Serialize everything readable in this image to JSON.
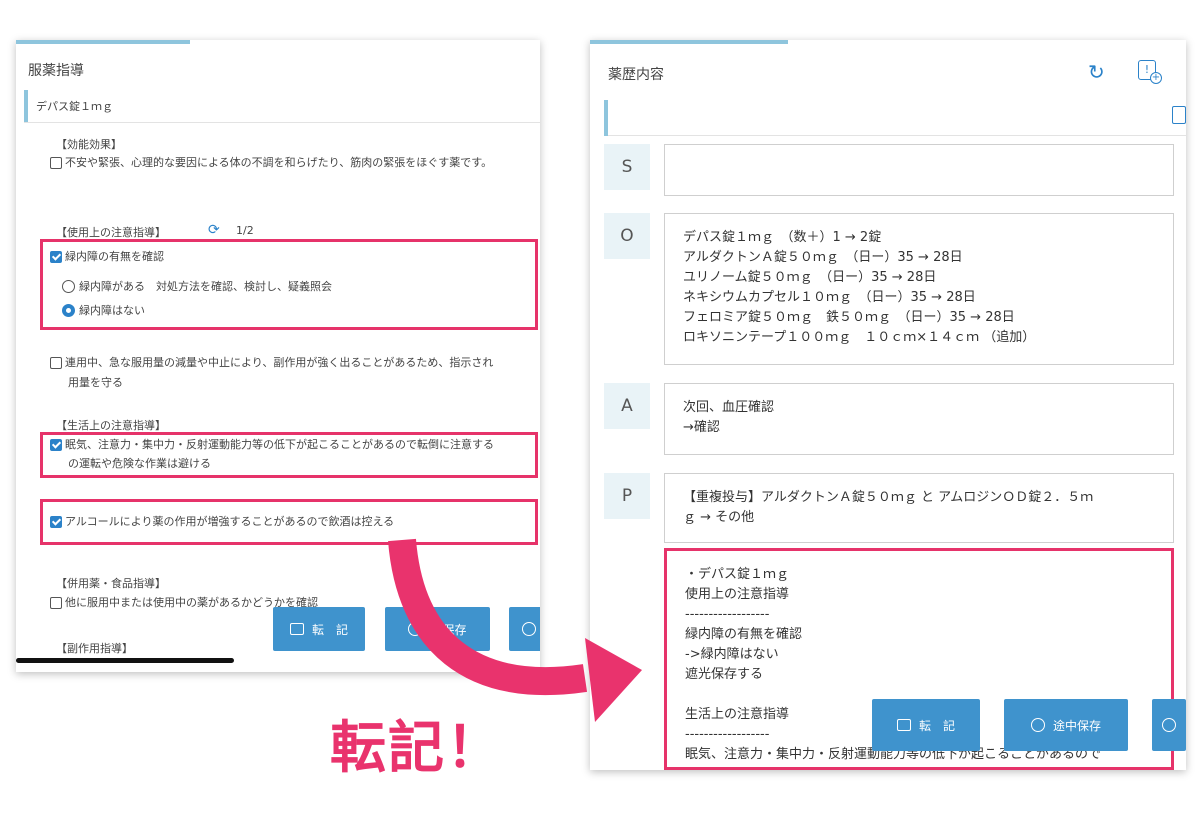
{
  "left_panel": {
    "title": "服薬指導",
    "drug": "デパス錠１ｍｇ",
    "effect_heading": "【効能効果】",
    "effect_text": "不安や緊張、心理的な要因による体の不調を和らげたり、筋肉の緊張をほぐす薬です。",
    "usage_heading": "【使用上の注意指導】",
    "usage_page": "1/2",
    "glaucoma_check": "緑内障の有無を確認",
    "radio_option_1": "緑内障がある　対処方法を確認、検討し、疑義照会",
    "radio_option_2": "緑内障はない",
    "dose_note_line1": "連用中、急な服用量の減量や中止により、副作用が強く出ることがあるため、指示され",
    "dose_note_line2": "用量を守る",
    "life_heading": "【生活上の注意指導】",
    "drowsy_line1": "眠気、注意力・集中力・反射運動能力等の低下が起こることがあるので転倒に注意する",
    "drowsy_line2": "の運転や危険な作業は避ける",
    "alcohol": "アルコールにより薬の作用が増強することがあるので飲酒は控える",
    "combo_heading": "【併用薬・食品指導】",
    "combo_check": "他に服用中または使用中の薬があるかどうかを確認",
    "side_heading": "【副作用指導】",
    "btn_transfer": "転　記",
    "btn_save": "中保存"
  },
  "right_panel": {
    "title": "薬歴内容",
    "s_label": "S",
    "s_text": "",
    "o_label": "O",
    "o_text": "デパス錠１ｍｇ　（数＋）1 → 2錠\nアルダクトンＡ錠５０ｍｇ　（日ー）35 → 28日\nユリノーム錠５０ｍｇ　（日ー）35 → 28日\nネキシウムカプセル１０ｍｇ　（日ー）35 → 28日\nフェロミア錠５０ｍｇ　鉄５０ｍｇ　（日ー）35 → 28日\nロキソニンテープ１００ｍｇ　１０ｃｍ×１４ｃｍ （追加）",
    "a_label": "A",
    "a_text": "次回、血圧確認\n→確認",
    "p_label": "P",
    "p_text": "【重複投与】アルダクトンＡ錠５０ｍｇ と アムロジンＯＤ錠２．５ｍ\nｇ → その他",
    "p_detail": "・デパス錠１ｍｇ\n使用上の注意指導\n------------------\n緑内障の有無を確認\n->緑内障はない\n遮光保存する\n\n生活上の注意指導\n------------------\n眠気、注意力・集中力・反射運動能力等の低下が起こることがあるので",
    "btn_transfer": "転　記",
    "btn_save": "途中保存"
  },
  "callout": "転記！",
  "colors": {
    "accent": "#8ec5dd",
    "button": "#3f93cd",
    "highlight": "#e6336a"
  }
}
